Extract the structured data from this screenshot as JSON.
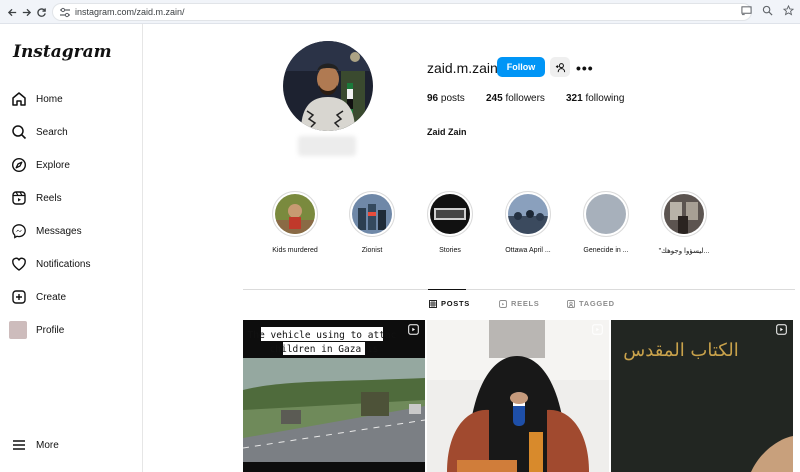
{
  "browser": {
    "url": "instagram.com/zaid.m.zain/"
  },
  "sidebar": {
    "logo": "Instagram",
    "items": [
      {
        "label": "Home",
        "icon": "home-icon"
      },
      {
        "label": "Search",
        "icon": "search-icon"
      },
      {
        "label": "Explore",
        "icon": "compass-icon"
      },
      {
        "label": "Reels",
        "icon": "reels-icon"
      },
      {
        "label": "Messages",
        "icon": "messenger-icon"
      },
      {
        "label": "Notifications",
        "icon": "heart-icon"
      },
      {
        "label": "Create",
        "icon": "plus-square-icon"
      },
      {
        "label": "Profile",
        "icon": "profile-thumbnail"
      }
    ],
    "more": "More"
  },
  "profile": {
    "username": "zaid.m.zain",
    "follow_label": "Follow",
    "more_label": "•••",
    "posts_count": "96",
    "posts_label": "posts",
    "followers_count": "245",
    "followers_label": "followers",
    "following_count": "321",
    "following_label": "following",
    "full_name": "Zaid Zain"
  },
  "highlights": [
    {
      "title": "Kids murdered"
    },
    {
      "title": "Zionist"
    },
    {
      "title": "Stories"
    },
    {
      "title": "Ottawa April ..."
    },
    {
      "title": "Genecide in ..."
    },
    {
      "title": "\"ليسؤوا وجوهك..."
    }
  ],
  "tabs": [
    {
      "label": "POSTS",
      "icon": "grid-icon",
      "active": true
    },
    {
      "label": "REELS",
      "icon": "reels-icon",
      "active": false
    },
    {
      "label": "TAGGED",
      "icon": "tag-icon",
      "active": false
    }
  ],
  "posts": [
    {
      "caption_line1": "The vehicle using to attac",
      "caption_line2": "children in Gaza is"
    },
    {
      "caption_line1": ""
    },
    {
      "caption_line1": "الكتاب المقدس"
    }
  ],
  "colors": {
    "accent": "#0095f6",
    "border": "#dbdbdb",
    "muted": "#8e8e8e"
  }
}
